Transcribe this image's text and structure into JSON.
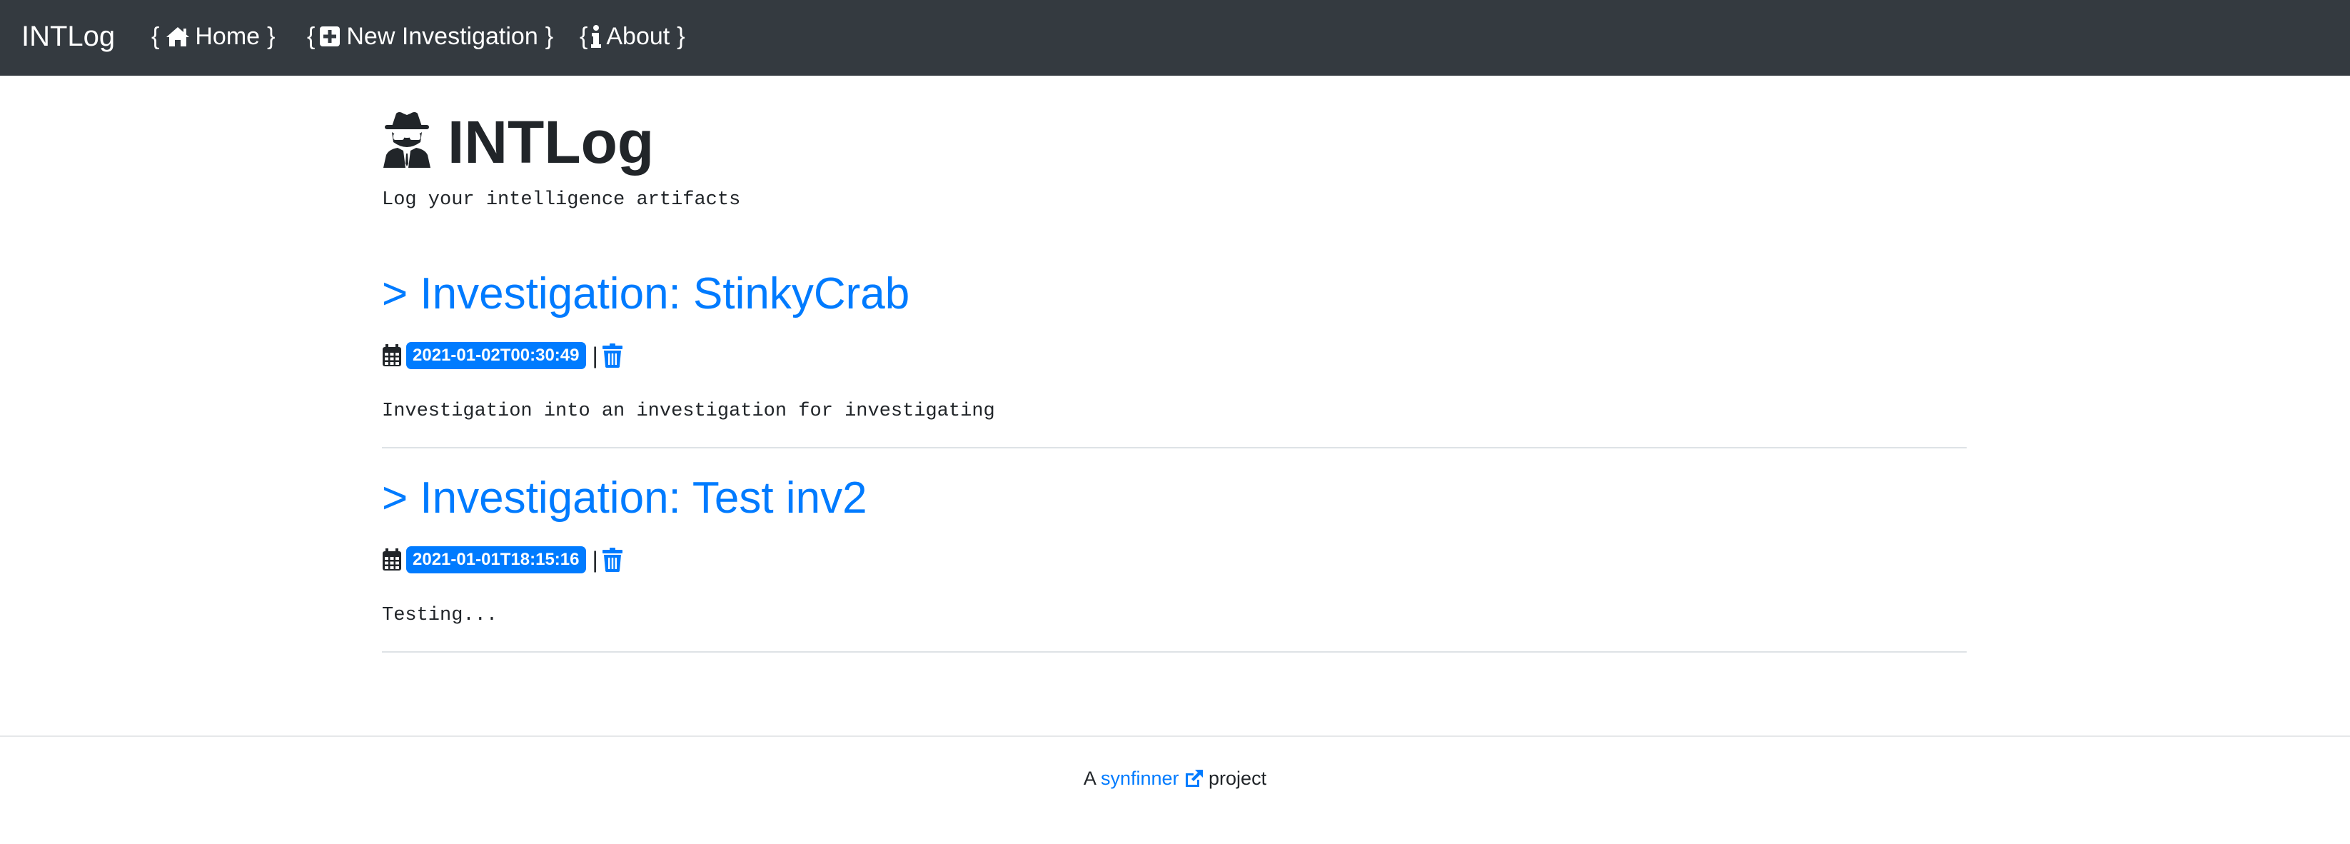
{
  "navbar": {
    "brand": "INTLog",
    "items": [
      {
        "brace_open": "{",
        "label": "Home",
        "brace_close": "}",
        "icon": "home-icon"
      },
      {
        "brace_open": "{",
        "label": "New Investigation",
        "brace_close": "}",
        "icon": "plus-square-icon"
      },
      {
        "brace_open": "{",
        "label": "About",
        "brace_close": "}",
        "icon": "info-icon"
      }
    ],
    "background": "#343a40"
  },
  "header": {
    "title": "INTLog",
    "icon": "user-secret-icon",
    "tagline": "Log your intelligence artifacts"
  },
  "investigations": [
    {
      "title": "> Investigation: StinkyCrab",
      "timestamp": "2021-01-02T00:30:49",
      "separator": "|",
      "description": "Investigation into an investigation for investigating"
    },
    {
      "title": "> Investigation: Test inv2",
      "timestamp": "2021-01-01T18:15:16",
      "separator": "|",
      "description": "Testing..."
    }
  ],
  "footer": {
    "prefix": "A",
    "link_text": "synfinner",
    "suffix": "project",
    "icon": "external-link-icon"
  },
  "colors": {
    "accent": "#007bff",
    "text": "#212529",
    "rule": "#dee2e6"
  }
}
